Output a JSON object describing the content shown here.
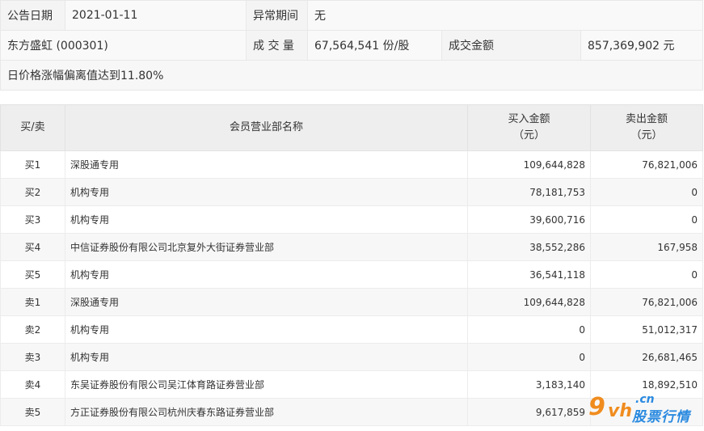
{
  "info": {
    "date_label": "公告日期",
    "date_value": "2021-01-11",
    "period_label": "异常期间",
    "period_value": "无",
    "stock": "东方盛虹 (000301)",
    "volume_label": "成 交 量",
    "volume_value": "67,564,541 份/股",
    "amount_label": "成交金额",
    "amount_value": "857,369,902 元",
    "reason": "日价格涨幅偏离值达到11.80%"
  },
  "table": {
    "headers": {
      "side": "买/卖",
      "name": "会员营业部名称",
      "buy_line1": "买入金额",
      "buy_line2": "（元）",
      "sell_line1": "卖出金额",
      "sell_line2": "（元）"
    },
    "rows": [
      {
        "side": "买1",
        "name": "深股通专用",
        "buy": "109,644,828",
        "sell": "76,821,006"
      },
      {
        "side": "买2",
        "name": "机构专用",
        "buy": "78,181,753",
        "sell": "0"
      },
      {
        "side": "买3",
        "name": "机构专用",
        "buy": "39,600,716",
        "sell": "0"
      },
      {
        "side": "买4",
        "name": "中信证券股份有限公司北京复外大街证券营业部",
        "buy": "38,552,286",
        "sell": "167,958"
      },
      {
        "side": "买5",
        "name": "机构专用",
        "buy": "36,541,118",
        "sell": "0"
      },
      {
        "side": "卖1",
        "name": "深股通专用",
        "buy": "109,644,828",
        "sell": "76,821,006"
      },
      {
        "side": "卖2",
        "name": "机构专用",
        "buy": "0",
        "sell": "51,012,317"
      },
      {
        "side": "卖3",
        "name": "机构专用",
        "buy": "0",
        "sell": "26,681,465"
      },
      {
        "side": "卖4",
        "name": "东吴证券股份有限公司吴江体育路证券营业部",
        "buy": "3,183,140",
        "sell": "18,892,510"
      },
      {
        "side": "卖5",
        "name": "方正证券股份有限公司杭州庆春东路证券营业部",
        "buy": "9,617,859",
        "sell": ""
      }
    ]
  },
  "watermark": {
    "nine": "9",
    "vh": "vh",
    "cn": ".cn",
    "site": "股票行情",
    "color_orange": "#f08c1e",
    "color_blue": "#2a8ae0"
  }
}
